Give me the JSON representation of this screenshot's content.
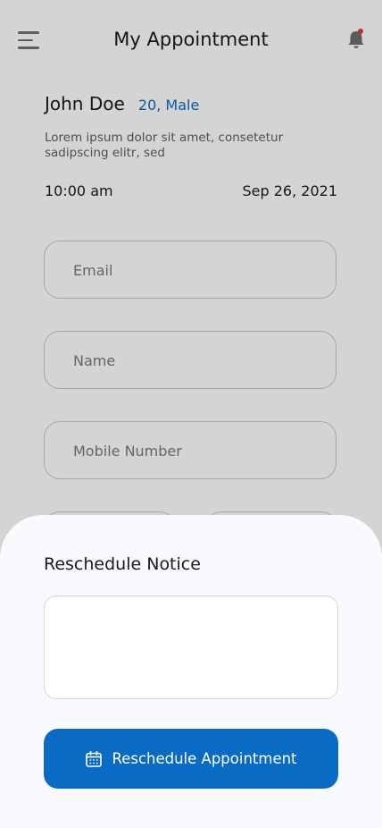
{
  "header": {
    "title": "My Appointment",
    "icons": {
      "menu": "hamburger-menu-icon",
      "notification": "bell-icon"
    }
  },
  "patient": {
    "name": "John Doe",
    "meta": "20, Male",
    "description": "Lorem ipsum dolor sit amet, consetetur sadipscing elitr, sed",
    "time": "10:00 am",
    "date": "Sep 26, 2021"
  },
  "form": {
    "email_placeholder": "Email",
    "name_placeholder": "Name",
    "mobile_placeholder": "Mobile Number"
  },
  "sheet": {
    "title": "Reschedule Notice",
    "notice_value": "",
    "button_label": "Reschedule Appointment",
    "button_icon": "calendar-icon"
  },
  "colors": {
    "accent": "#0a6bc4",
    "meta_text": "#0b6cc5",
    "notification_dot": "#e53935",
    "overlay": "rgba(0,0,0,0.17)",
    "sheet_bg": "#f8fafe"
  }
}
